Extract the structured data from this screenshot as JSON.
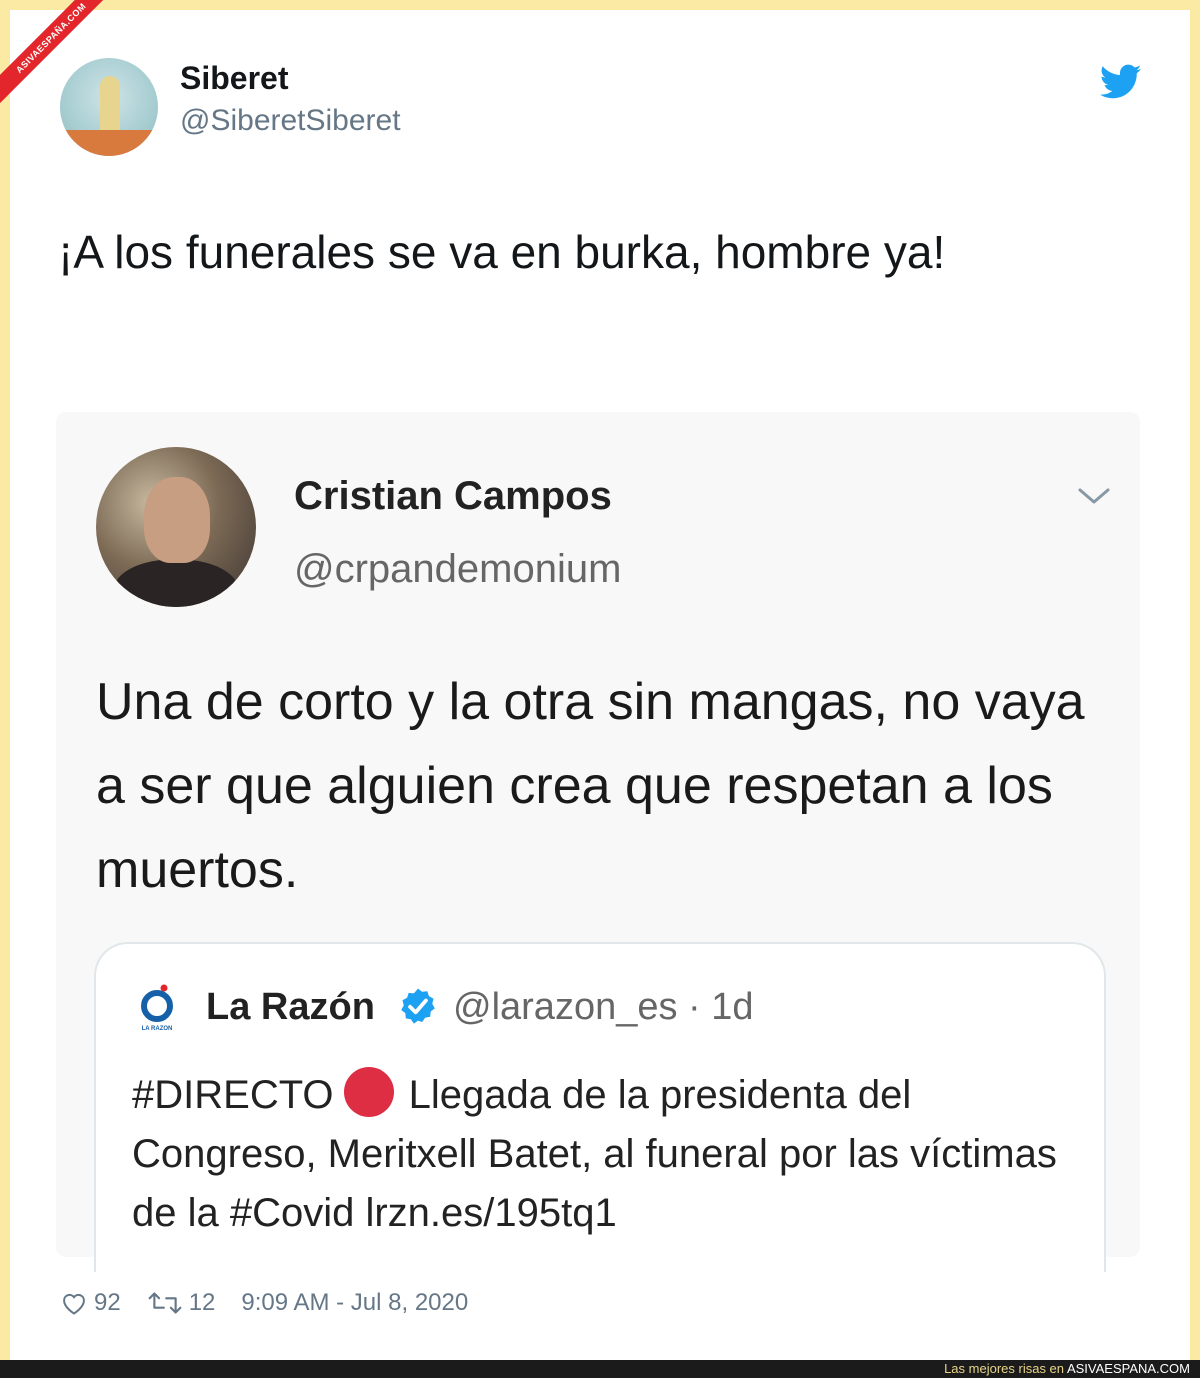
{
  "ribbon": {
    "text": "ASIVAESPAÑA.COM"
  },
  "tweet": {
    "author_name": "Siberet",
    "author_handle": "@SiberetSiberet",
    "text": "¡A los funerales se va en burka, hombre ya!",
    "likes": "92",
    "retweets": "12",
    "timestamp": "9:09 AM - Jul 8, 2020"
  },
  "quoted": {
    "author_name": "Cristian Campos",
    "author_handle": "@crpandemonium",
    "text": "Una de corto y la otra sin mangas, no vaya a ser que alguien crea que respetan a los muertos."
  },
  "nested_quote": {
    "author_name": "La Razón",
    "author_handle": "@larazon_es",
    "age": "· 1d",
    "text_prefix": "#DIRECTO",
    "text_body": "Llegada de la presidenta del Congreso, Meritxell Batet, al funeral por las víctimas de la #Covid lrzn.es/195tq1",
    "logo_caption": "LA RAZON"
  },
  "footer_bar": {
    "tagline": "Las mejores risas en",
    "site": "ASIVAESPANA.COM"
  },
  "colors": {
    "frame": "#fbeaa3",
    "twitter_blue": "#1da1f2",
    "verified_blue": "#1da1f2",
    "red_dot": "#dd2e44"
  },
  "icons": [
    "twitter-bird-icon",
    "chevron-down-icon",
    "verified-icon",
    "heart-icon",
    "retweet-icon",
    "red-circle-icon"
  ]
}
